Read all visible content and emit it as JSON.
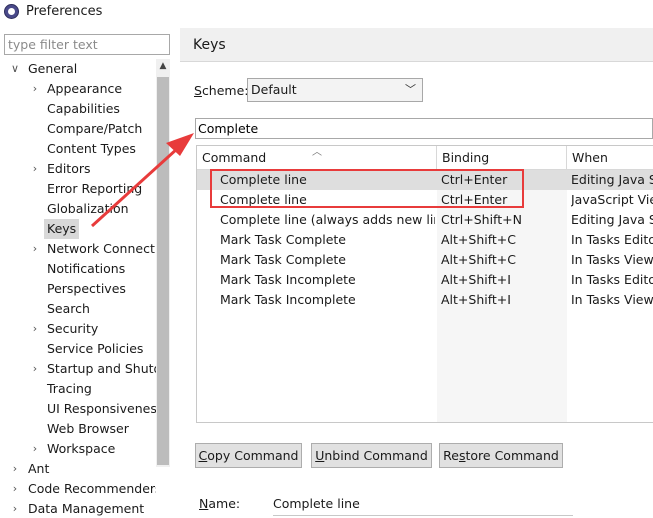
{
  "window": {
    "title": "Preferences",
    "icon": "eclipse-icon"
  },
  "filter": {
    "placeholder": "type filter text"
  },
  "tree": {
    "items": [
      {
        "label": "General",
        "depth": 0,
        "arrow": "expanded"
      },
      {
        "label": "Appearance",
        "depth": 1,
        "arrow": "collapsed"
      },
      {
        "label": "Capabilities",
        "depth": 1,
        "arrow": "none"
      },
      {
        "label": "Compare/Patch",
        "depth": 1,
        "arrow": "none"
      },
      {
        "label": "Content Types",
        "depth": 1,
        "arrow": "none"
      },
      {
        "label": "Editors",
        "depth": 1,
        "arrow": "collapsed"
      },
      {
        "label": "Error Reporting",
        "depth": 1,
        "arrow": "none"
      },
      {
        "label": "Globalization",
        "depth": 1,
        "arrow": "none"
      },
      {
        "label": "Keys",
        "depth": 1,
        "arrow": "none",
        "selected": true
      },
      {
        "label": "Network Connectio",
        "depth": 1,
        "arrow": "collapsed"
      },
      {
        "label": "Notifications",
        "depth": 1,
        "arrow": "none"
      },
      {
        "label": "Perspectives",
        "depth": 1,
        "arrow": "none"
      },
      {
        "label": "Search",
        "depth": 1,
        "arrow": "none"
      },
      {
        "label": "Security",
        "depth": 1,
        "arrow": "collapsed"
      },
      {
        "label": "Service Policies",
        "depth": 1,
        "arrow": "none"
      },
      {
        "label": "Startup and Shutd",
        "depth": 1,
        "arrow": "collapsed"
      },
      {
        "label": "Tracing",
        "depth": 1,
        "arrow": "none"
      },
      {
        "label": "UI Responsiveness",
        "depth": 1,
        "arrow": "none"
      },
      {
        "label": "Web Browser",
        "depth": 1,
        "arrow": "none"
      },
      {
        "label": "Workspace",
        "depth": 1,
        "arrow": "collapsed"
      },
      {
        "label": "Ant",
        "depth": 0,
        "arrow": "collapsed"
      },
      {
        "label": "Code Recommenders",
        "depth": 0,
        "arrow": "collapsed"
      },
      {
        "label": "Data Management",
        "depth": 0,
        "arrow": "collapsed"
      }
    ]
  },
  "page": {
    "title": "Keys"
  },
  "scheme": {
    "label": "Scheme:",
    "mnemonic": "S",
    "rest": "cheme:",
    "value": "Default"
  },
  "command_filter": {
    "value": "Complete"
  },
  "table": {
    "columns": [
      "Command",
      "Binding",
      "When"
    ],
    "rows": [
      {
        "command": "Complete line",
        "binding": "Ctrl+Enter",
        "when": "Editing Java So",
        "selected": true
      },
      {
        "command": "Complete line",
        "binding": "Ctrl+Enter",
        "when": "JavaScript View"
      },
      {
        "command": "Complete line (always adds new line)",
        "binding": "Ctrl+Shift+N",
        "when": "Editing Java So"
      },
      {
        "command": "Mark Task Complete",
        "binding": "Alt+Shift+C",
        "when": "In Tasks Editor"
      },
      {
        "command": "Mark Task Complete",
        "binding": "Alt+Shift+C",
        "when": "In Tasks View"
      },
      {
        "command": "Mark Task Incomplete",
        "binding": "Alt+Shift+I",
        "when": "In Tasks Editor"
      },
      {
        "command": "Mark Task Incomplete",
        "binding": "Alt+Shift+I",
        "when": "In Tasks View"
      }
    ]
  },
  "buttons": {
    "copy": {
      "mnemonic": "C",
      "rest": "opy Command"
    },
    "unbind": {
      "mnemonic": "U",
      "rest": "nbind Command"
    },
    "restore": {
      "pre": "Re",
      "mnemonic": "s",
      "rest": "tore Command"
    }
  },
  "details": {
    "name_mnemonic": "N",
    "name_rest": "ame:",
    "name_value": "Complete line"
  },
  "annotation": {
    "color": "#e83b3b"
  },
  "colors": {
    "selection": "#dedede",
    "accent": "#e83b3b"
  }
}
